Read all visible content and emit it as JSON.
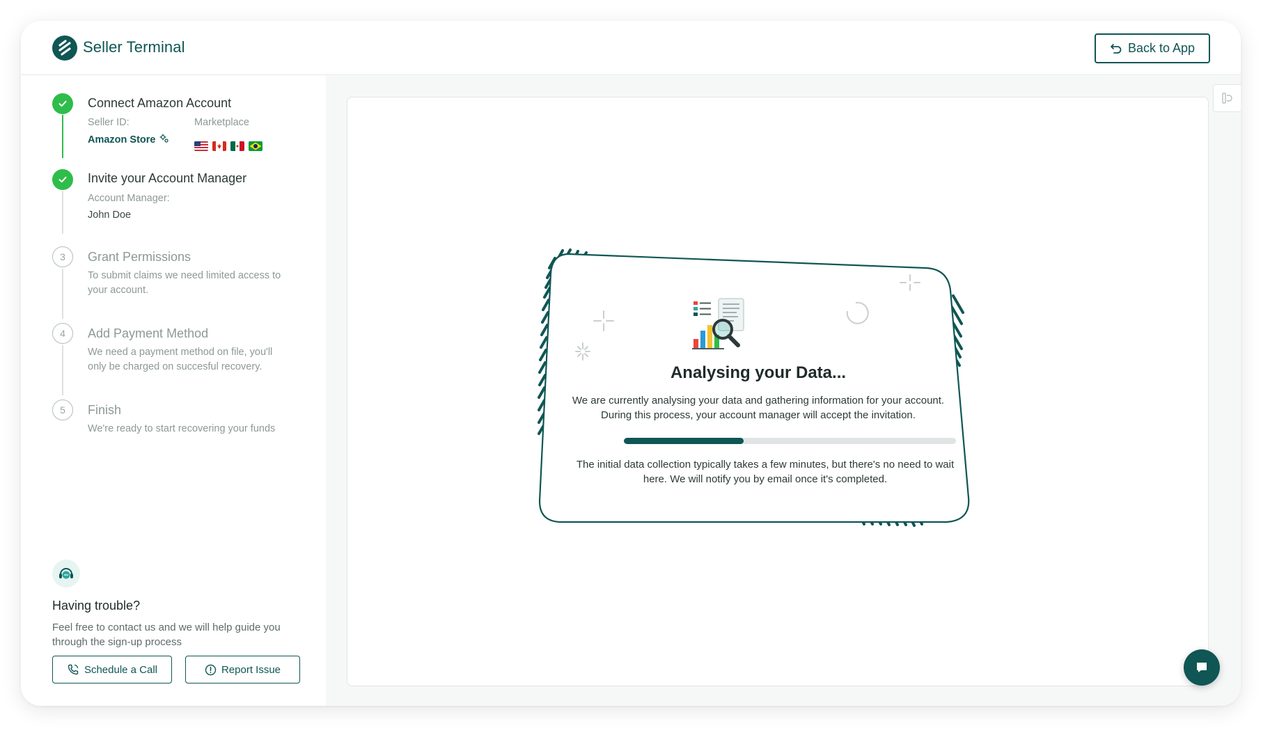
{
  "header": {
    "brand": "Seller Terminal",
    "back_label": "Back to App"
  },
  "steps": [
    {
      "number": "",
      "status": "done",
      "title": "Connect Amazon Account",
      "seller_id_label": "Seller ID:",
      "seller_id_value": "Amazon Store",
      "marketplace_label": "Marketplace",
      "marketplace_flags": [
        "us-flag",
        "canada-flag",
        "mexico-flag",
        "brazil-flag"
      ]
    },
    {
      "number": "",
      "status": "done",
      "title": "Invite your Account Manager",
      "manager_label": "Account Manager:",
      "manager_value": "John Doe"
    },
    {
      "number": "3",
      "status": "todo",
      "title": "Grant Permissions",
      "description_line1": "To submit claims we need limited access to",
      "description_line2": "your account."
    },
    {
      "number": "4",
      "status": "todo",
      "title": "Add Payment Method",
      "description_line1": "We need a payment method on file, you'll",
      "description_line2": "only be charged on succesful recovery."
    },
    {
      "number": "5",
      "status": "todo",
      "title": "Finish",
      "description_line1": "We're ready to start recovering your funds"
    }
  ],
  "help": {
    "title": "Having trouble?",
    "text": "Feel free to contact us and we will help guide you through the sign-up process",
    "schedule_label": "Schedule a Call",
    "report_label": "Report Issue"
  },
  "card": {
    "title": "Analysing your Data...",
    "text": "We are currently analysing your data and gathering information for your account. During this process, your account manager will accept the invitation.",
    "progress": 0.36,
    "note": "The initial data collection typically takes a few minutes, but there's no need to wait here. We will notify you by email once it's completed."
  },
  "colors": {
    "brand": "#0f5654",
    "success": "#2ebd4a",
    "muted_text": "#8e9898"
  },
  "icons": {
    "logo": "seller-terminal-logo",
    "back": "undo-arrow-icon",
    "chat": "chat-bubble-icon",
    "help": "headset-chat-icon"
  }
}
